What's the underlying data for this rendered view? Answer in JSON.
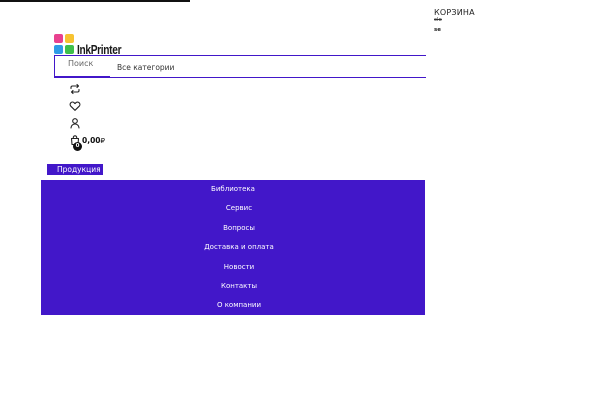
{
  "logo": {
    "text": "InkPrinter",
    "colors": [
      "#e8418f",
      "#f7c331",
      "#2e9be6",
      "#3fbf4a"
    ]
  },
  "search": {
    "placeholder": "Поиск",
    "category": "Все категории"
  },
  "header_icons": [
    "compare-icon",
    "heart-icon",
    "user-icon",
    "cart-icon"
  ],
  "cart": {
    "count": "0",
    "total": "0,00",
    "currency": "₽",
    "title": "КОРЗИНА",
    "sub1": "clo",
    "sub2": "se"
  },
  "products_tab": {
    "label": "Продукция"
  },
  "menu": {
    "items": [
      "Библиотека",
      "Сервис",
      "Вопросы",
      "Доставка и оплата",
      "Новости",
      "Контакты",
      "О компании"
    ]
  },
  "colors": {
    "accent": "#4217c9",
    "text": "#222222",
    "background": "#ffffff"
  }
}
